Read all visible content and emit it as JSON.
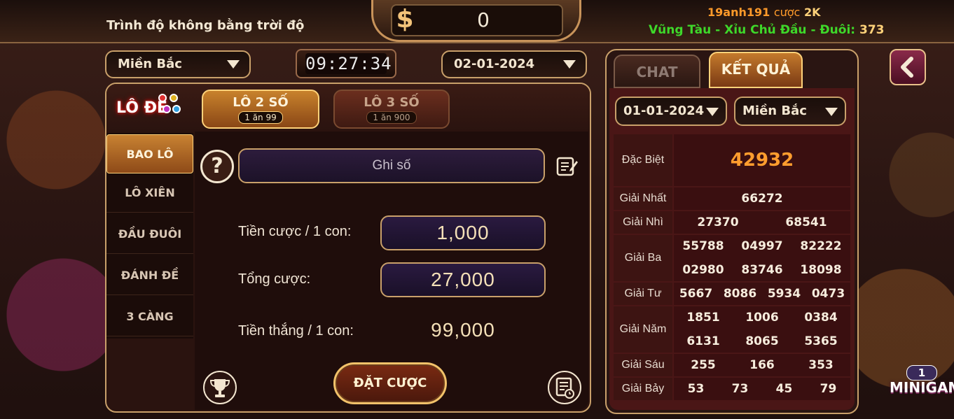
{
  "header": {
    "title": "Trình độ không bằng trời độ",
    "balance_symbol": "$",
    "balance": "0",
    "ticker": {
      "user": "19anh191",
      "action": "cược",
      "amount": "2K",
      "line2_text": "Vũng Tàu - Xỉu Chủ Đầu - Đuôi:",
      "line2_number": "373"
    }
  },
  "filters": {
    "region": "Miền Bắc",
    "timer": "09:27:34",
    "date": "02-01-2024"
  },
  "bet_panel": {
    "logo": "LÔ ĐỀ",
    "tabs": [
      {
        "title": "LÔ 2 SỐ",
        "sub": "1 ăn 99",
        "active": true
      },
      {
        "title": "LÔ 3 SỐ",
        "sub": "1 ăn 900",
        "active": false
      }
    ],
    "side_menu": [
      "BAO LÔ",
      "LÔ XIÊN",
      "ĐẦU ĐUÔI",
      "ĐÁNH ĐỀ",
      "3 CÀNG"
    ],
    "active_side_item": "BAO LÔ",
    "help_symbol": "?",
    "number_input_placeholder": "Ghi số",
    "stake_label": "Tiền cược / 1 con:",
    "stake_value": "1,000",
    "total_label": "Tổng cược:",
    "total_value": "27,000",
    "win_label": "Tiền thắng / 1 con:",
    "win_value": "99,000",
    "submit_label": "ĐẶT CƯỢC"
  },
  "results_panel": {
    "tabs": [
      {
        "label": "CHAT",
        "active": false
      },
      {
        "label": "KẾT QUẢ",
        "active": true
      }
    ],
    "date": "01-01-2024",
    "region": "Miền Bắc",
    "prizes": [
      {
        "label": "Đặc Biệt",
        "numbers": [
          "42932"
        ]
      },
      {
        "label": "Giải Nhất",
        "numbers": [
          "66272"
        ]
      },
      {
        "label": "Giải Nhì",
        "numbers": [
          "27370",
          "68541"
        ]
      },
      {
        "label": "Giải Ba",
        "numbers": [
          "55788",
          "04997",
          "82222",
          "02980",
          "83746",
          "18098"
        ]
      },
      {
        "label": "Giải Tư",
        "numbers": [
          "5667",
          "8086",
          "5934",
          "0473"
        ]
      },
      {
        "label": "Giải Năm",
        "numbers": [
          "1851",
          "1006",
          "0384",
          "6131",
          "8065",
          "5365"
        ]
      },
      {
        "label": "Giải Sáu",
        "numbers": [
          "255",
          "166",
          "353"
        ]
      },
      {
        "label": "Giải Bảy",
        "numbers": [
          "53",
          "73",
          "45",
          "79"
        ]
      }
    ]
  },
  "minigame": {
    "label": "MINIGAME",
    "badge": "1"
  },
  "icons": [
    "dollar-icon",
    "caret-down-icon",
    "question-icon",
    "edit-icon",
    "trophy-icon",
    "history-icon",
    "back-arrow-icon"
  ],
  "colors": {
    "gold": "#c9a06a",
    "accent_orange": "#ff9d2e",
    "green_ticker": "#3ed82a"
  }
}
